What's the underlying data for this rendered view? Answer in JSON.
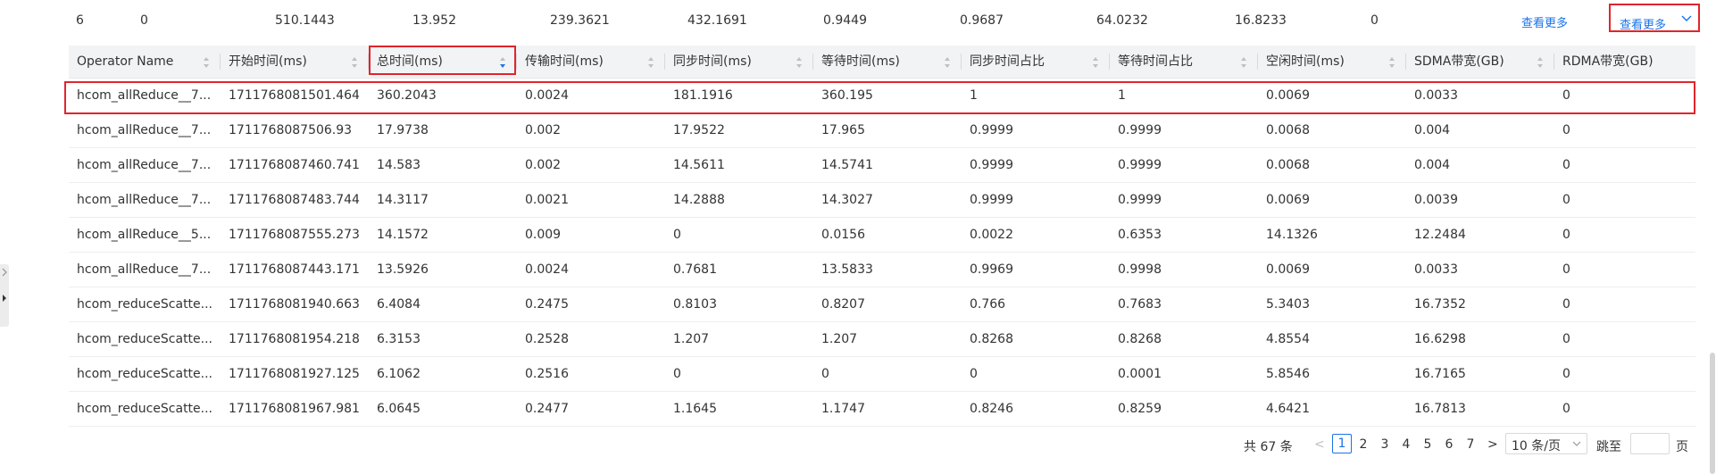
{
  "summary_row": {
    "cells": [
      "6",
      "0",
      "510.1443",
      "13.952",
      "239.3621",
      "432.1691",
      "0.9449",
      "0.9687",
      "64.0232",
      "16.8233",
      "0"
    ],
    "link_more_1": "查看更多",
    "link_more_2": "查看更多"
  },
  "table": {
    "columns": [
      "Operator Name",
      "开始时间(ms)",
      "总时间(ms)",
      "传输时间(ms)",
      "同步时间(ms)",
      "等待时间(ms)",
      "同步时间占比",
      "等待时间占比",
      "空闲时间(ms)",
      "SDMA带宽(GB)",
      "RDMA带宽(GB)"
    ],
    "rows": [
      [
        "hcom_allReduce__7...",
        "1711768081501.464",
        "360.2043",
        "0.0024",
        "181.1916",
        "360.195",
        "1",
        "1",
        "0.0069",
        "0.0033",
        "0"
      ],
      [
        "hcom_allReduce__7...",
        "1711768087506.93",
        "17.9738",
        "0.002",
        "17.9522",
        "17.965",
        "0.9999",
        "0.9999",
        "0.0068",
        "0.004",
        "0"
      ],
      [
        "hcom_allReduce__7...",
        "1711768087460.741",
        "14.583",
        "0.002",
        "14.5611",
        "14.5741",
        "0.9999",
        "0.9999",
        "0.0068",
        "0.004",
        "0"
      ],
      [
        "hcom_allReduce__7...",
        "1711768087483.744",
        "14.3117",
        "0.0021",
        "14.2888",
        "14.3027",
        "0.9999",
        "0.9999",
        "0.0069",
        "0.0039",
        "0"
      ],
      [
        "hcom_allReduce__5...",
        "1711768087555.273",
        "14.1572",
        "0.009",
        "0",
        "0.0156",
        "0.0022",
        "0.6353",
        "14.1326",
        "12.2484",
        "0"
      ],
      [
        "hcom_allReduce__7...",
        "1711768087443.171",
        "13.5926",
        "0.0024",
        "0.7681",
        "13.5833",
        "0.9969",
        "0.9998",
        "0.0069",
        "0.0033",
        "0"
      ],
      [
        "hcom_reduceScatte...",
        "1711768081940.663",
        "6.4084",
        "0.2475",
        "0.8103",
        "0.8207",
        "0.766",
        "0.7683",
        "5.3403",
        "16.7352",
        "0"
      ],
      [
        "hcom_reduceScatte...",
        "1711768081954.218",
        "6.3153",
        "0.2528",
        "1.207",
        "1.207",
        "0.8268",
        "0.8268",
        "4.8554",
        "16.6298",
        "0"
      ],
      [
        "hcom_reduceScatte...",
        "1711768081927.125",
        "6.1062",
        "0.2516",
        "0",
        "0",
        "0",
        "0.0001",
        "5.8546",
        "16.7165",
        "0"
      ],
      [
        "hcom_reduceScatte...",
        "1711768081967.981",
        "6.0645",
        "0.2477",
        "1.1645",
        "1.1747",
        "0.8246",
        "0.8259",
        "4.6421",
        "16.7813",
        "0"
      ]
    ],
    "sorted_column": "总时间(ms)",
    "sort_direction": "descending"
  },
  "pagination": {
    "total": "共 67 条",
    "prev": "<",
    "next": ">",
    "pages": [
      "1",
      "2",
      "3",
      "4",
      "5",
      "6",
      "7"
    ],
    "current_page": "1",
    "page_size": "10 条/页",
    "jump_label": "跳至",
    "jump_suffix": "页",
    "jump_value": ""
  },
  "icons": {
    "sort": "sort-caret-icon",
    "chevron": "chevron-down-icon",
    "panel_toggle": "panel-toggle-arrow-icon"
  },
  "colors": {
    "link": "#1a73e8",
    "highlight": "#e0252c",
    "header_bg": "#f2f3f5",
    "sort_active": "#1a73e8"
  }
}
